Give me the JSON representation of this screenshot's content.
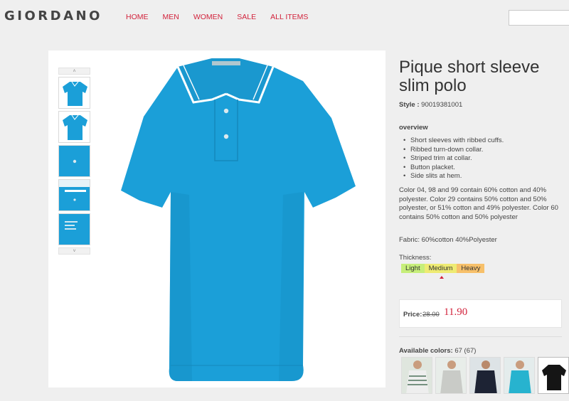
{
  "header": {
    "logo": "GIORDANO",
    "nav": [
      {
        "label": "HOME"
      },
      {
        "label": "MEN"
      },
      {
        "label": "WOMEN"
      },
      {
        "label": "SALE"
      },
      {
        "label": "ALL ITEMS"
      }
    ]
  },
  "gallery": {
    "up_arrow": "˄",
    "down_arrow": "˅",
    "shirt_color": "#1b9fd8",
    "thumbnails": [
      "front-view",
      "front-view",
      "button-closeup",
      "collar-closeup",
      "label-closeup"
    ]
  },
  "product": {
    "title": "Pique short sleeve slim polo",
    "style_label": "Style :",
    "style_number": "90019381001",
    "overview_heading": "overview",
    "features": [
      "Short sleeves with ribbed cuffs.",
      "Ribbed turn-down collar.",
      "Striped trim at collar.",
      "Button placket.",
      "Side slits at hem."
    ],
    "color_description": "Color 04, 98 and 99 contain 60% cotton and 40% polyester. Color 29 contains 50% cotton and 50% polyester, or 51% cotton and 49% polyester. Color 60 contains 50% cotton and 50% polyester",
    "fabric": "Fabric: 60%cotton 40%Polyester",
    "thickness_label": "Thickness:",
    "thickness_options": [
      "Light",
      "Medium",
      "Heavy"
    ],
    "thickness_selected": "Medium",
    "price_label": "Price:",
    "price_original": "28.00",
    "price_sale": "11.90",
    "colors_label": "Available colors:",
    "colors_count": "67 (67)",
    "color_swatches": [
      {
        "name": "white-stripe",
        "color": "#e8e8e8"
      },
      {
        "name": "grey",
        "color": "#c9cbc7"
      },
      {
        "name": "navy",
        "color": "#1d2334"
      },
      {
        "name": "turquoise",
        "color": "#27b3cf"
      },
      {
        "name": "black",
        "color": "#151515"
      }
    ]
  }
}
